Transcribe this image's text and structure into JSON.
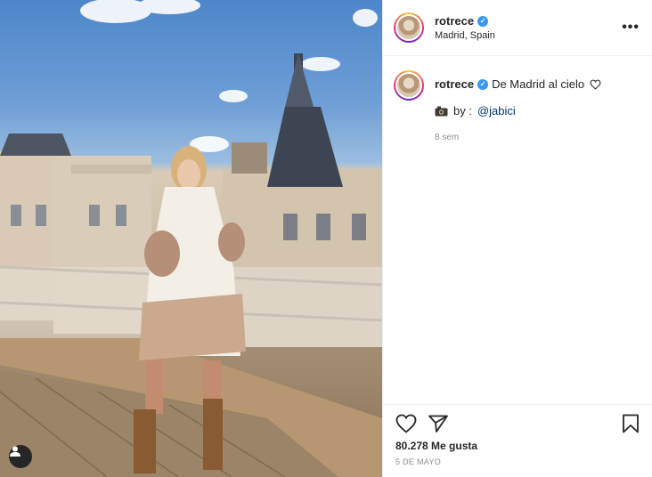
{
  "post": {
    "author": {
      "username": "rotrece",
      "location": "Madrid, Spain"
    },
    "caption": {
      "text": "De Madrid al cielo",
      "credit_prefix": "by :",
      "credit_mention": "@jabici",
      "time_ago": "8 sem"
    },
    "likes": "80.278 Me gusta",
    "date": "5 DE MAYO"
  },
  "icons": {
    "verified": "verified-badge-icon",
    "more": "more-options-icon",
    "like": "heart-icon",
    "share": "paper-plane-icon",
    "save": "bookmark-icon",
    "camera": "camera-emoji-icon",
    "user_tag": "user-tag-icon"
  },
  "colors": {
    "verified": "#3897f0",
    "mention": "#00376b",
    "muted": "#8e8e8e"
  }
}
